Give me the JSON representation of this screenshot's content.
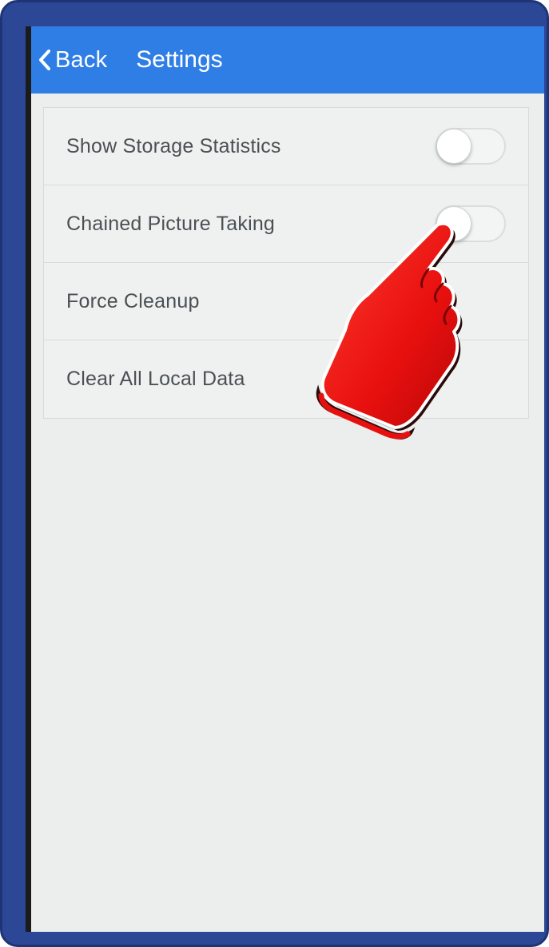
{
  "navbar": {
    "back_label": "Back",
    "title": "Settings",
    "color": "#2f7ee6"
  },
  "settings": {
    "items": [
      {
        "label": "Show Storage Statistics",
        "toggle": true,
        "toggle_on": false
      },
      {
        "label": "Chained Picture Taking",
        "toggle": true,
        "toggle_on": false
      },
      {
        "label": "Force Cleanup",
        "toggle": false
      },
      {
        "label": "Clear All Local Data",
        "toggle": false
      }
    ]
  },
  "overlay": {
    "icon": "pointing-hand-icon",
    "color": "#e8100f"
  },
  "device_frame_color": "#2b4796"
}
